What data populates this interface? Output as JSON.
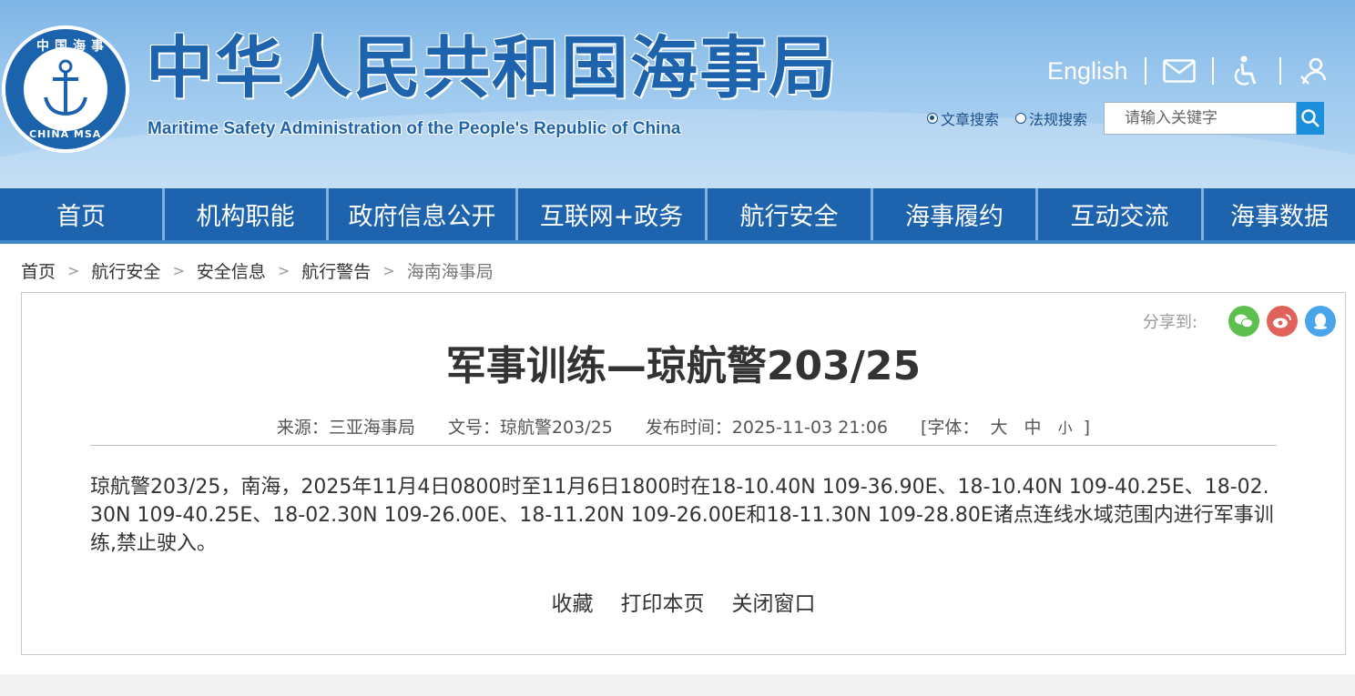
{
  "header": {
    "emblem": {
      "ring_top": "中国海事",
      "ring_bottom": "CHINA MSA"
    },
    "title_cn": "中华人民共和国海事局",
    "title_en": "Maritime Safety Administration of the People's Republic of China",
    "english_link": "English",
    "icons": [
      "mail-icon",
      "accessibility-icon",
      "care-mode-icon"
    ],
    "search": {
      "option_article": "文章搜索",
      "option_law": "法规搜索",
      "placeholder": "请输入关键字"
    }
  },
  "nav": {
    "items": [
      "首页",
      "机构职能",
      "政府信息公开",
      "互联网+政务",
      "航行安全",
      "海事履约",
      "互动交流",
      "海事数据"
    ]
  },
  "breadcrumb": [
    "首页",
    "航行安全",
    "安全信息",
    "航行警告",
    "海南海事局"
  ],
  "breadcrumb_sep": ">",
  "article": {
    "share_label": "分享到:",
    "title": "军事训练—琼航警203/25",
    "meta": {
      "source": "来源：三亚海事局",
      "doc_no": "文号：琼航警203/25",
      "published": "发布时间：2025-11-03 21:06",
      "font_open": "[字体：",
      "font_large": "大",
      "font_medium": "中",
      "font_small": "小",
      "font_close": "]"
    },
    "body": "琼航警203/25，南海，2025年11月4日0800时至11月6日1800时在18-10.40N 109-36.90E、18-10.40N 109-40.25E、18-02.30N 109-40.25E、18-02.30N 109-26.00E、18-11.20N 109-26.00E和18-11.30N 109-28.80E诸点连线水域范围内进行军事训练,禁止驶入。",
    "actions": [
      "收藏",
      "打印本页",
      "关闭窗口"
    ]
  },
  "colors": {
    "brand_blue": "#1d63ad",
    "nav_divider": "#7fb1df",
    "wechat": "#5cbf4e",
    "weibo": "#e0625a",
    "qq": "#4aa4ea"
  }
}
